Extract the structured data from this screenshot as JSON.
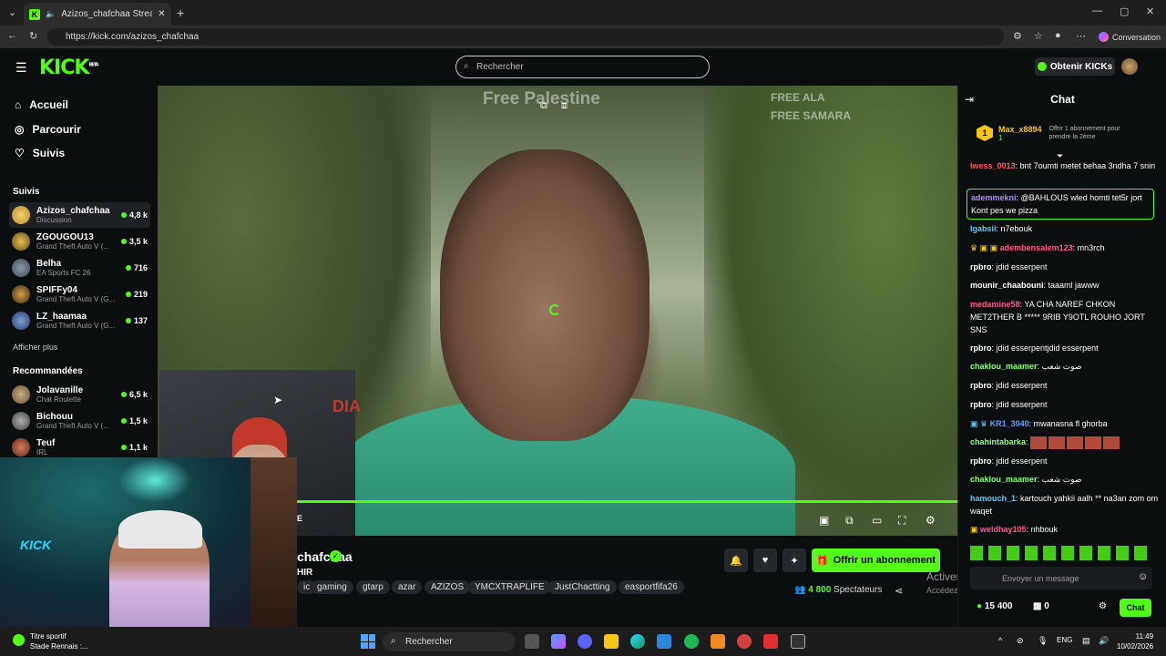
{
  "browser": {
    "tab_title": "Azizos_chafchaa Stream - Wa",
    "url": "https://kick.com/azizos_chafchaa",
    "conversation_label": "Conversation"
  },
  "header": {
    "logo": "KICK",
    "logo_badge": "BETA",
    "search_placeholder": "Rechercher",
    "get_kicks_label": "Obtenir KICKs"
  },
  "sidebar": {
    "nav": [
      {
        "label": "Accueil",
        "icon": "home-icon"
      },
      {
        "label": "Parcourir",
        "icon": "compass-icon"
      },
      {
        "label": "Suivis",
        "icon": "heart-icon"
      }
    ],
    "following_title": "Suivis",
    "following": [
      {
        "name": "Azizos_chafchaa",
        "category": "Discussion",
        "viewers": "4,8 k"
      },
      {
        "name": "ZGOUGOU13",
        "category": "Grand Theft Auto V (...",
        "viewers": "3,5 k"
      },
      {
        "name": "Belha",
        "category": "EA Sports FC 26",
        "viewers": "716"
      },
      {
        "name": "SPIFFy04",
        "category": "Grand Theft Auto V (G...",
        "viewers": "219"
      },
      {
        "name": "LZ_haamaa",
        "category": "Grand Theft Auto V (G...",
        "viewers": "137"
      }
    ],
    "show_more": "Afficher plus",
    "recommended_title": "Recommandées",
    "recommended": [
      {
        "name": "Jolavanille",
        "category": "Chat Roulette",
        "viewers": "6,5 k"
      },
      {
        "name": "Bichouu",
        "category": "Grand Theft Auto V (...",
        "viewers": "1,5 k"
      },
      {
        "name": "Teuf",
        "category": "IRL",
        "viewers": "1,1 k"
      }
    ]
  },
  "video": {
    "banner_left": "Free Palestine",
    "banner_right_1": "FREE ALA",
    "banner_right_2": "FREE SAMARA",
    "inset_text": "DIA",
    "live_badge": "E",
    "progress": 1.0
  },
  "webcam": {
    "sign": "KICK"
  },
  "channel": {
    "name": "chafchaa",
    "subtitle": "HIR",
    "tags": [
      "ic",
      "gaming",
      "gtarp",
      "azar",
      "AZIZOS",
      "YMCXTRAPLIFE",
      "JustChactting",
      "easportfifa26"
    ],
    "subscribe_label": "Offrir un abonnement",
    "viewers_count": "4 800",
    "viewers_label": "Spectateurs"
  },
  "windows_watermark": {
    "line1": "Activer Wi",
    "line2": "Accédez aux paramètres pour activer Windows."
  },
  "chat": {
    "title": "Chat",
    "pinned": {
      "rank": "1",
      "user": "Max_x8894",
      "count": "1",
      "offer": "Offrir 1 abonnement pour prendre la 2ème"
    },
    "messages": [
      {
        "user": "lwess_0013",
        "color": "#ff5b5b",
        "text": "bnt 7oumti metet behaa 3ndha 7 snin"
      },
      {
        "user": "ademmekni",
        "color": "#b18cff",
        "text": "@BAHLOUS wled homti tet5r jort Kont pes we pizza"
      },
      {
        "user": "lgabsii",
        "color": "#5ec8ff",
        "text": "n7ebouk"
      },
      {
        "user": "adembensalem123",
        "color": "#ff5b8a",
        "text": "mn3rch"
      },
      {
        "user": "rpbro",
        "color": "#ffffff",
        "text": "jdid esserpent"
      },
      {
        "user": "mounir_chaabouni",
        "color": "#ffffff",
        "text": "taaaml jawww"
      },
      {
        "user": "medamine58",
        "color": "#ff5b8a",
        "text": "YA CHA NAREF CHKON MET2THER B ***** 9RIB Y9OTL ROUHO JORT SNS"
      },
      {
        "user": "rpbro",
        "color": "#ffffff",
        "text": "jdid esserpentjdid esserpent"
      },
      {
        "user": "chaklou_maamer",
        "color": "#8cff7a",
        "text": "صوت شعب"
      },
      {
        "user": "rpbro",
        "color": "#ffffff",
        "text": "jdid esserpent"
      },
      {
        "user": "rpbro",
        "color": "#ffffff",
        "text": "jdid esserpent"
      },
      {
        "user": "KR1_3040",
        "color": "#5ea0ff",
        "text": "mwanasna fl ghorba"
      },
      {
        "user": "chahintabarka",
        "color": "#8cff7a",
        "text": ""
      },
      {
        "user": "rpbro",
        "color": "#ffffff",
        "text": "jdid esserpent"
      },
      {
        "user": "chaklou_maamer",
        "color": "#8cff7a",
        "text": "صوت شعب"
      },
      {
        "user": "hamouch_1",
        "color": "#5ec8ff",
        "text": "kartouch yahkii aalh ** na3an zom om waqet"
      },
      {
        "user": "weldhay105",
        "color": "#ff5b8a",
        "text": "nhbouk"
      }
    ],
    "input_placeholder": "Envoyer un message",
    "kicks_balance": "15 400",
    "gift_count": "0",
    "send_label": "Chat"
  },
  "taskbar": {
    "weather_title": "Titre sportif",
    "weather_sub": "Stade Rennais :...",
    "search_label": "Rechercher",
    "lang": "ENG",
    "time": "11:49",
    "date": "10/02/2026"
  },
  "colors": {
    "accent": "#53fc18",
    "background": "#0b0e0f"
  }
}
